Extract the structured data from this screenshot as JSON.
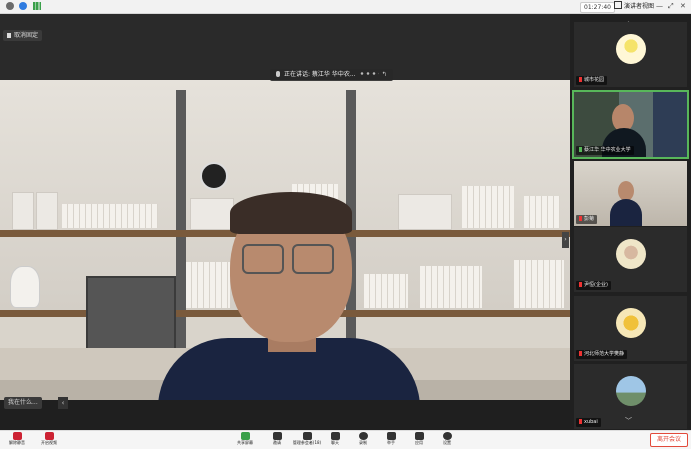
{
  "topbar": {
    "timer": "01:27:40",
    "view_button": "演讲者视图",
    "controls": [
      "—",
      "⤢",
      "✕"
    ]
  },
  "stage": {
    "unpin_label": "取消固定",
    "speaking_label": "正在讲话: 蔡江华 华中农...",
    "back_glyph": "↰",
    "bottom_left_label": "我在什么...",
    "collapse_glyph": "‹",
    "right_arrow_glyph": "›"
  },
  "gallery": {
    "up_glyph": "︿",
    "down_glyph": "﹀",
    "participants": [
      {
        "name": "城市花园"
      },
      {
        "name": "蔡江华 华中农业大学"
      },
      {
        "name": "彭菊"
      },
      {
        "name": "尹恒(企业)"
      },
      {
        "name": "河北师范大学樊静"
      },
      {
        "name": "xubai"
      }
    ]
  },
  "toolbar": {
    "buttons": [
      {
        "label": "解除静音"
      },
      {
        "label": "开启视频"
      },
      {
        "label": "共享屏幕"
      },
      {
        "label": "邀请"
      },
      {
        "label": "管理参会者(18)"
      },
      {
        "label": "聊天"
      },
      {
        "label": "录制"
      },
      {
        "label": "举手"
      },
      {
        "label": "应用"
      },
      {
        "label": "设置"
      }
    ],
    "leave_label": "离开会议"
  },
  "colors": {
    "active_outline": "#58b75a",
    "leave_red": "#e24a3b",
    "muted_red": "#e33333"
  }
}
